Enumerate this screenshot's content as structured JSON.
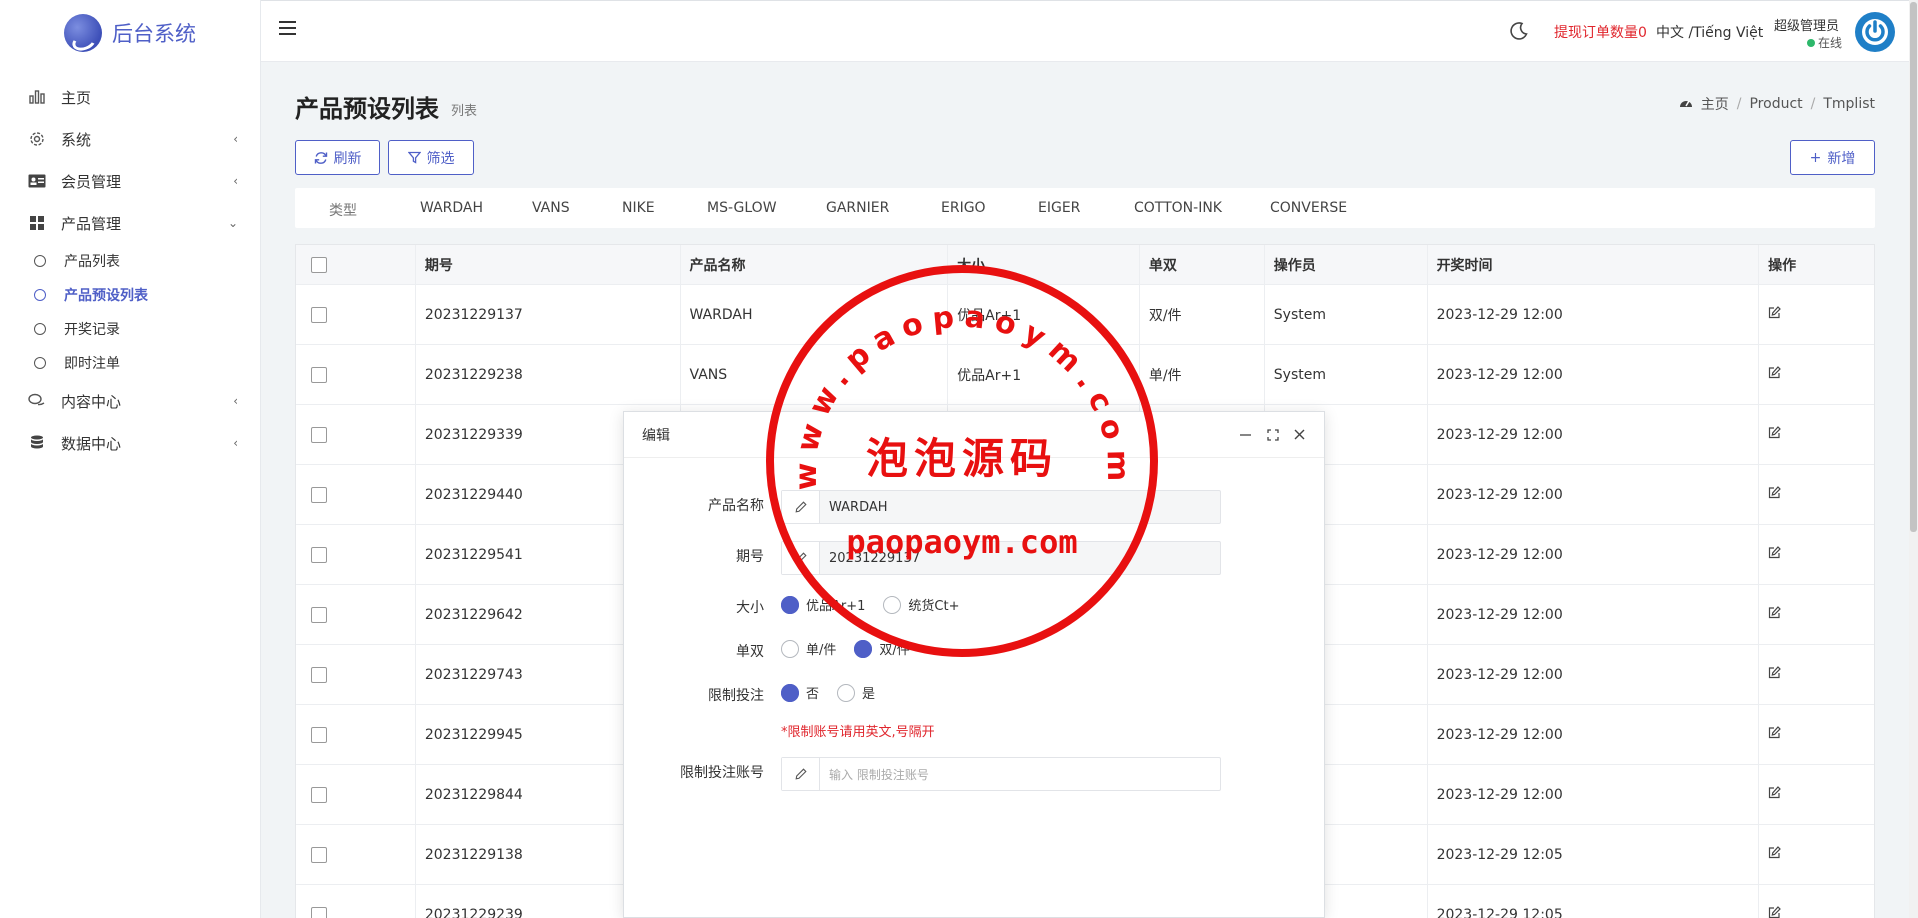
{
  "sidebar": {
    "logo_text": "后台系统",
    "items": [
      {
        "label": "主页",
        "icon": "bar-chart-icon"
      },
      {
        "label": "系统",
        "icon": "gear-icon"
      },
      {
        "label": "会员管理",
        "icon": "id-card-icon"
      },
      {
        "label": "产品管理",
        "icon": "grid-icon"
      },
      {
        "label": "内容中心",
        "icon": "chat-icon"
      },
      {
        "label": "数据中心",
        "icon": "database-icon"
      }
    ],
    "product_sub": [
      {
        "label": "产品列表"
      },
      {
        "label": "产品预设列表"
      },
      {
        "label": "开奖记录"
      },
      {
        "label": "即时注单"
      }
    ]
  },
  "topbar": {
    "withdraw_label": "提现订单数量0",
    "lang_label": "中文 /Tiếng Việt",
    "admin_name": "超级管理员",
    "admin_status": "在线"
  },
  "page": {
    "title": "产品预设列表",
    "subtitle": "列表",
    "breadcrumb": [
      "主页",
      "Product",
      "Tmplist"
    ],
    "refresh_label": "刷新",
    "filter_label": "筛选",
    "add_label": "新增"
  },
  "categories": [
    "类型",
    "WARDAH",
    "VANS",
    "NIKE",
    "MS-GLOW",
    "GARNIER",
    "ERIGO",
    "EIGER",
    "COTTON-INK",
    "CONVERSE"
  ],
  "table": {
    "headers": [
      "期号",
      "产品名称",
      "大小",
      "单双",
      "操作员",
      "开奖时间",
      "操作"
    ],
    "rows": [
      {
        "issue": "20231229137",
        "name": "WARDAH",
        "size": "优品Ar+1",
        "parity": "双/件",
        "operator": "System",
        "time": "2023-12-29 12:00"
      },
      {
        "issue": "20231229238",
        "name": "VANS",
        "size": "优品Ar+1",
        "parity": "单/件",
        "operator": "System",
        "time": "2023-12-29 12:00"
      },
      {
        "issue": "20231229339",
        "name": "",
        "size": "",
        "parity": "",
        "operator": "",
        "time": "2023-12-29 12:00"
      },
      {
        "issue": "20231229440",
        "name": "",
        "size": "",
        "parity": "",
        "operator": "",
        "time": "2023-12-29 12:00"
      },
      {
        "issue": "20231229541",
        "name": "",
        "size": "",
        "parity": "",
        "operator": "",
        "time": "2023-12-29 12:00"
      },
      {
        "issue": "20231229642",
        "name": "",
        "size": "",
        "parity": "",
        "operator": "",
        "time": "2023-12-29 12:00"
      },
      {
        "issue": "20231229743",
        "name": "",
        "size": "",
        "parity": "",
        "operator": "",
        "time": "2023-12-29 12:00"
      },
      {
        "issue": "20231229945",
        "name": "",
        "size": "",
        "parity": "",
        "operator": "",
        "time": "2023-12-29 12:00"
      },
      {
        "issue": "20231229844",
        "name": "",
        "size": "",
        "parity": "",
        "operator": "",
        "time": "2023-12-29 12:00"
      },
      {
        "issue": "20231229138",
        "name": "",
        "size": "",
        "parity": "",
        "operator": "",
        "time": "2023-12-29 12:05"
      },
      {
        "issue": "20231229239",
        "name": "",
        "size": "",
        "parity": "",
        "operator": "",
        "time": "2023-12-29 12:05"
      }
    ]
  },
  "modal": {
    "title": "编辑",
    "name_label": "产品名称",
    "name_value": "WARDAH",
    "issue_label": "期号",
    "issue_value": "20231229137",
    "size_label": "大小",
    "size_options": [
      "优品Ar+1",
      "统货Ct+"
    ],
    "size_selected": 0,
    "parity_label": "单双",
    "parity_options": [
      "单/件",
      "双/件"
    ],
    "parity_selected": 1,
    "limit_label": "限制投注",
    "limit_options": [
      "否",
      "是"
    ],
    "limit_selected": 0,
    "hint": "*限制账号请用英文,号隔开",
    "account_label": "限制投注账号",
    "account_placeholder": "输入 限制投注账号"
  },
  "watermark": {
    "arc_text": "www.paopaoym.com",
    "center_text": "泡泡源码",
    "bottom_text": "paopaoym.com"
  },
  "colors": {
    "primary": "#4f5fc7",
    "danger": "#e0262d",
    "seal_red": "#e81010",
    "online": "#2db86b"
  }
}
